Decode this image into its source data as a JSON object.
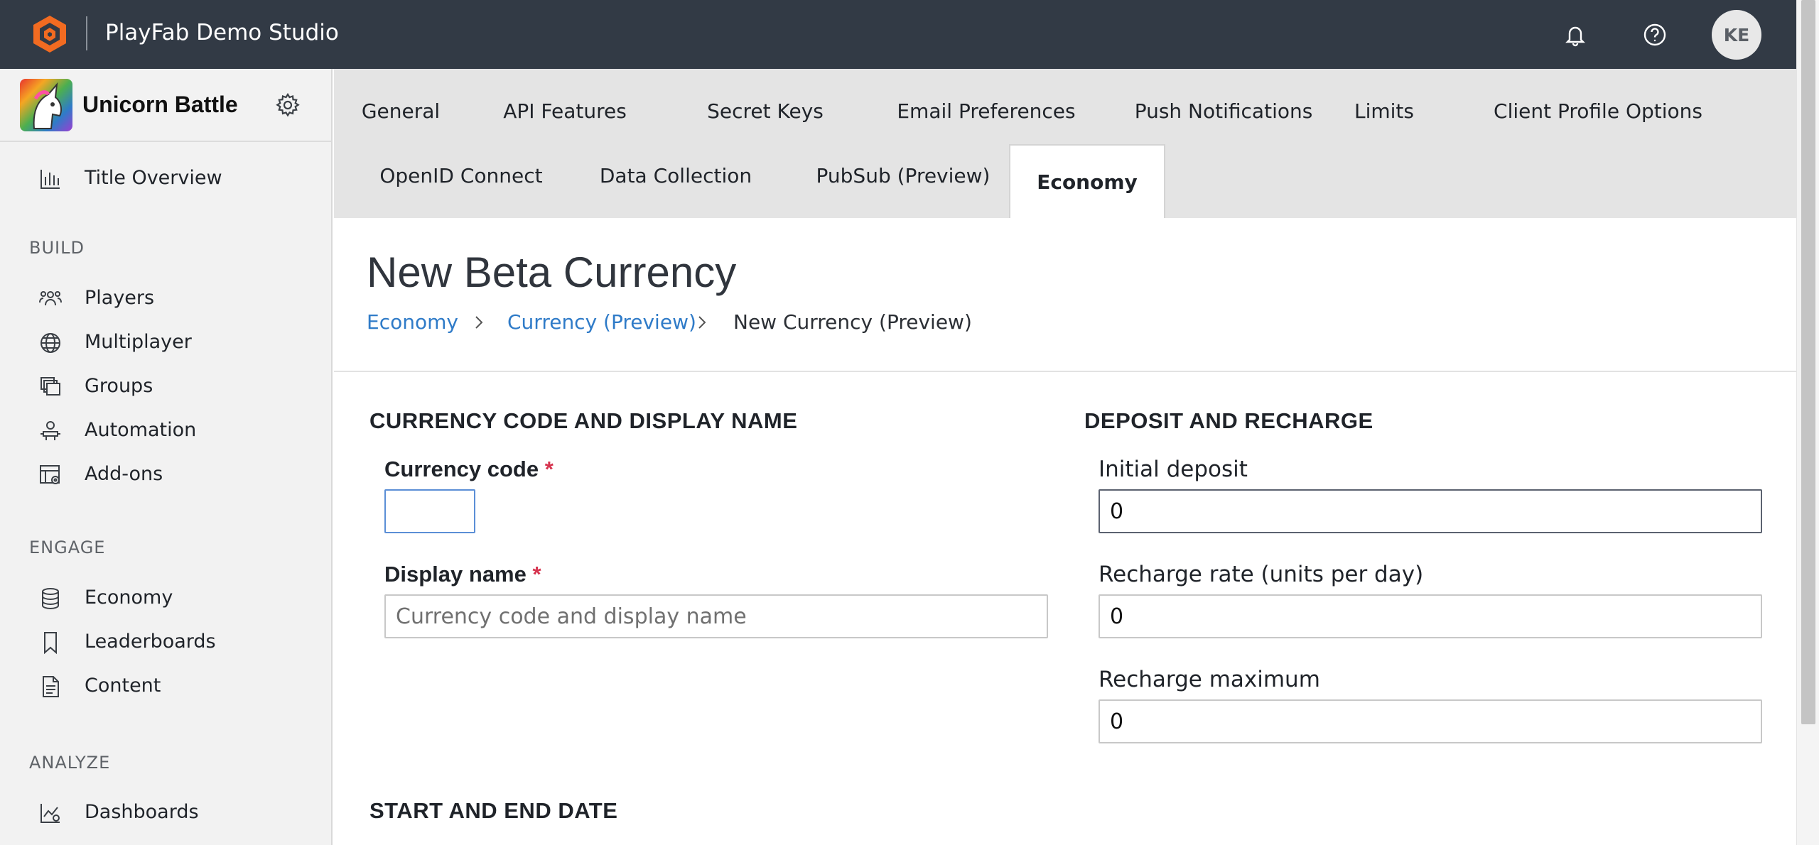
{
  "app": {
    "studio_name": "PlayFab Demo Studio",
    "user_initials": "KE"
  },
  "sidebar": {
    "title_name": "Unicorn Battle",
    "overview_label": "Title Overview",
    "sections": {
      "build": "BUILD",
      "engage": "ENGAGE",
      "analyze": "ANALYZE"
    },
    "items": [
      {
        "label": "Players",
        "icon": "players-icon"
      },
      {
        "label": "Multiplayer",
        "icon": "globe-icon"
      },
      {
        "label": "Groups",
        "icon": "groups-icon"
      },
      {
        "label": "Automation",
        "icon": "robot-icon"
      },
      {
        "label": "Add-ons",
        "icon": "addons-icon"
      },
      {
        "label": "Economy",
        "icon": "coins-icon"
      },
      {
        "label": "Leaderboards",
        "icon": "bookmark-icon"
      },
      {
        "label": "Content",
        "icon": "document-icon"
      },
      {
        "label": "Dashboards",
        "icon": "dashboard-icon"
      }
    ]
  },
  "tabs": [
    {
      "label": "General"
    },
    {
      "label": "API Features"
    },
    {
      "label": "Secret Keys"
    },
    {
      "label": "Email Preferences"
    },
    {
      "label": "Push Notifications"
    },
    {
      "label": "Limits"
    },
    {
      "label": "Client Profile Options"
    },
    {
      "label": "OpenID Connect"
    },
    {
      "label": "Data Collection"
    },
    {
      "label": "PubSub (Preview)"
    },
    {
      "label": "Economy",
      "active": true
    }
  ],
  "page": {
    "title": "New Beta Currency",
    "breadcrumb": [
      "Economy",
      "Currency (Preview)",
      "New Currency (Preview)"
    ]
  },
  "form": {
    "currency_section": {
      "heading": "CURRENCY CODE AND DISPLAY NAME",
      "code_label": "Currency code",
      "code_value": "",
      "display_label": "Display name",
      "display_value": "",
      "display_placeholder": "Currency code and display name",
      "required_marker": "*"
    },
    "deposit_section": {
      "heading": "DEPOSIT AND RECHARGE",
      "initial_label": "Initial deposit",
      "initial_value": "0",
      "rate_label": "Recharge rate (units per day)",
      "rate_value": "0",
      "max_label": "Recharge maximum",
      "max_value": "0"
    },
    "date_section": {
      "heading": "START AND END DATE"
    }
  },
  "colors": {
    "topbar": "#323a45",
    "brand_orange": "#f26b21",
    "link_blue": "#2f7bc8",
    "required_red": "#d6334e"
  }
}
